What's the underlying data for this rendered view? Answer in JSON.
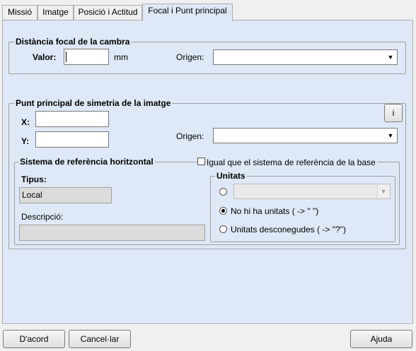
{
  "tabs": [
    {
      "label": "Missió"
    },
    {
      "label": "Imatge"
    },
    {
      "label": "Posició i Actitud"
    },
    {
      "label": "Focal i Punt principal"
    }
  ],
  "focal": {
    "legend": "Distància focal de la cambra",
    "valor_label": "Valor:",
    "valor_value": "",
    "unit": "mm",
    "origen_label": "Origen:",
    "origen_value": ""
  },
  "principal": {
    "legend": "Punt principal de simetria de la imatge",
    "x_label": "X:",
    "x_value": "",
    "y_label": "Y:",
    "y_value": "",
    "origen_label": "Origen:",
    "origen_value": "",
    "info_button": "i"
  },
  "refsys": {
    "legend": "Sistema de referència horitzontal",
    "same_as_base_label": "Igual que el sistema de referència de la base",
    "same_as_base_checked": false,
    "tipus_label": "Tipus:",
    "tipus_value": "Local",
    "descripcio_label": "Descripció:",
    "descripcio_value": ""
  },
  "units": {
    "legend": "Unitats",
    "options": [
      {
        "label": "",
        "selected": false
      },
      {
        "label": "No hi ha unitats ( -> \" \")",
        "selected": true
      },
      {
        "label": "Unitats desconegudes ( -> \"?\")",
        "selected": false
      }
    ],
    "combo_value": ""
  },
  "buttons": {
    "ok": "D'acord",
    "cancel": "Cancel·lar",
    "help": "Ajuda"
  }
}
